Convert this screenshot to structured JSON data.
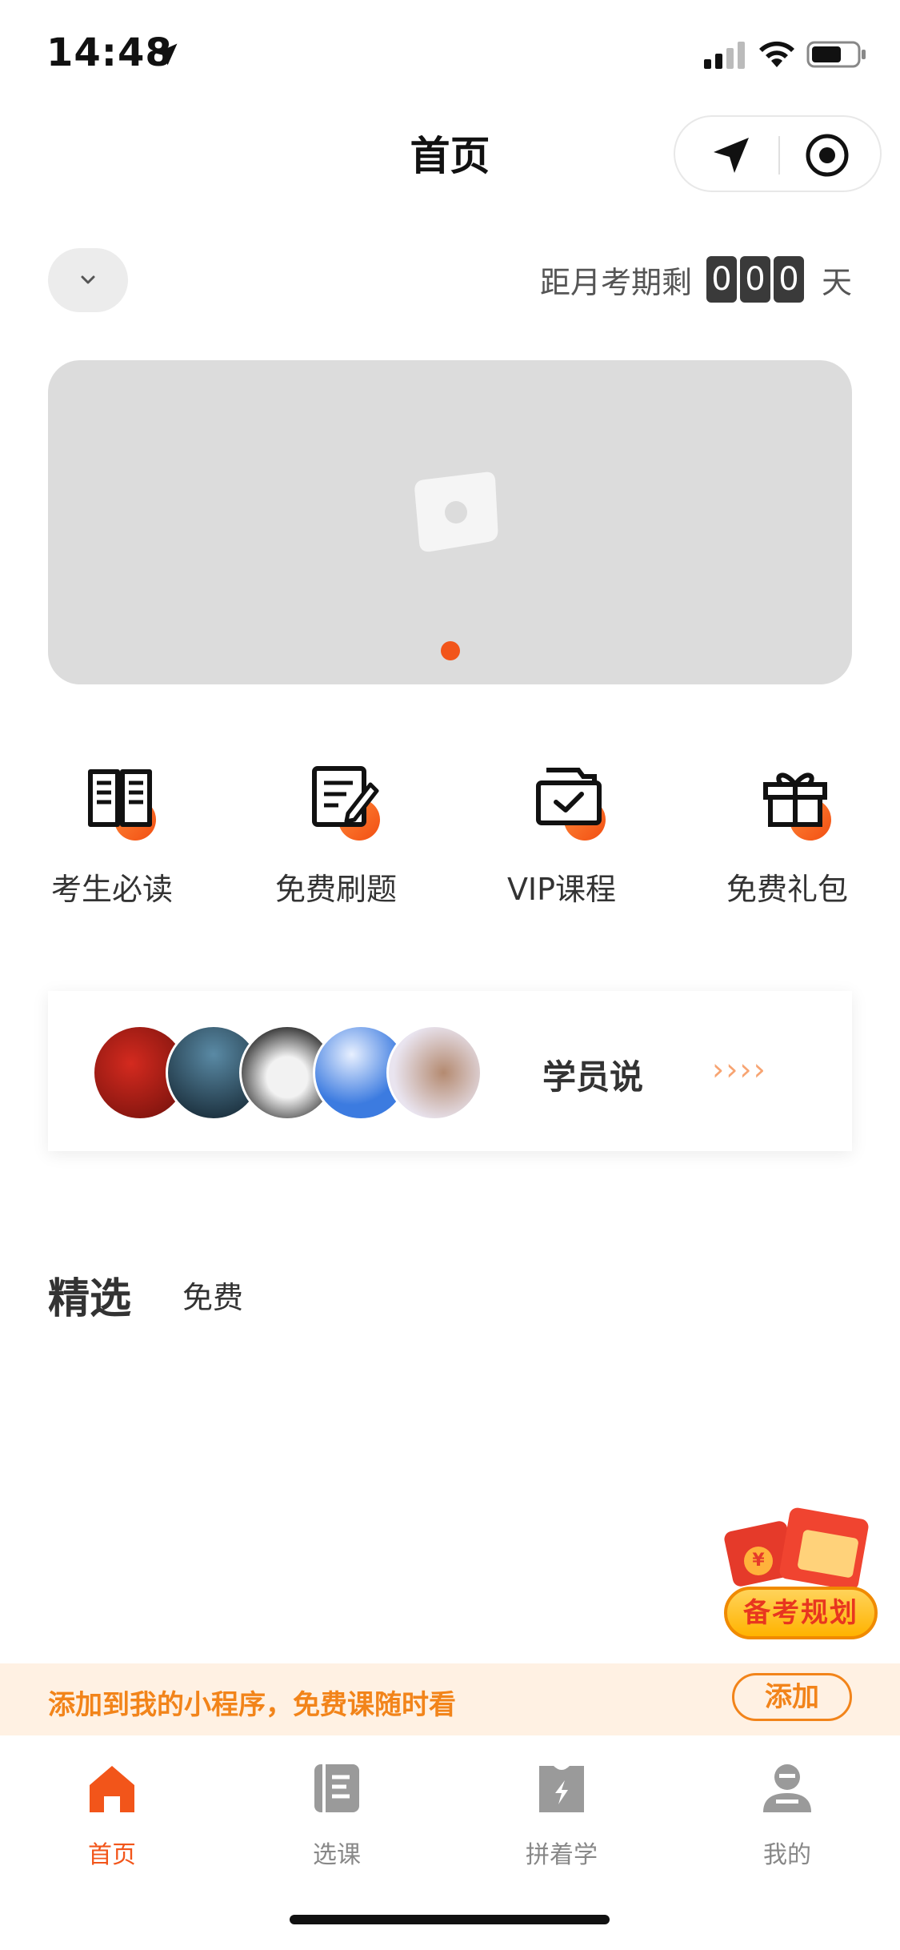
{
  "status_bar": {
    "time": "14:48"
  },
  "nav": {
    "title": "首页"
  },
  "countdown": {
    "label": "距月考期剩",
    "digits": [
      "0",
      "0",
      "0"
    ],
    "unit": "天"
  },
  "quick_menu": [
    {
      "label": "考生必读",
      "icon": "book-icon"
    },
    {
      "label": "免费刷题",
      "icon": "edit-note-icon"
    },
    {
      "label": "VIP课程",
      "icon": "folder-check-icon"
    },
    {
      "label": "免费礼包",
      "icon": "gift-icon"
    }
  ],
  "students": {
    "title": "学员说",
    "arrows": "››››"
  },
  "tabs": {
    "featured": "精选",
    "free": "免费"
  },
  "float_badge": {
    "label": "备考规划",
    "coin": "¥"
  },
  "add_bar": {
    "text": "添加到我的小程序，免费课随时看",
    "button": "添加"
  },
  "tab_bar": [
    {
      "label": "首页",
      "icon": "home-icon",
      "active": true
    },
    {
      "label": "选课",
      "icon": "course-list-icon",
      "active": false
    },
    {
      "label": "拼着学",
      "icon": "group-learn-icon",
      "active": false
    },
    {
      "label": "我的",
      "icon": "profile-icon",
      "active": false
    }
  ],
  "colors": {
    "accent": "#f2551a",
    "add_bar_text": "#f2841a",
    "add_bar_bg": "#fff1e3",
    "banner_bg": "#dcdcdc"
  }
}
